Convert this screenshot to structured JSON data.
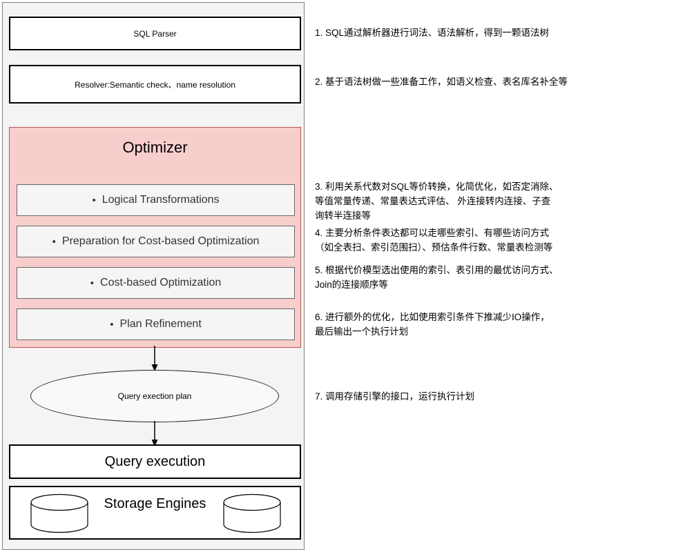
{
  "diagram": {
    "title": "SQL query processing pipeline",
    "colors": {
      "container_bg": "#f4f4f4",
      "container_border": "#808080",
      "optimizer_fill": "#f8cecc",
      "optimizer_border": "#b85450",
      "subbox_fill": "#f5f5f5",
      "subbox_border": "#666666",
      "box_border": "#000000"
    },
    "nodes": {
      "sql_parser": "SQL Parser",
      "resolver": "Resolver:Semantic check、name resolution",
      "optimizer_title": "Optimizer",
      "optimizer_steps": [
        "Logical Transformations",
        "Preparation for Cost-based Optimization",
        "Cost-based Optimization",
        "Plan Refinement"
      ],
      "bullet_glyph": "•",
      "query_execution_plan": "Query exection plan",
      "query_execution": "Query execution",
      "storage_engines": "Storage Engines"
    }
  },
  "notes": [
    {
      "id": "note-1",
      "text": "1. SQL通过解析器进行词法、语法解析，得到一颗语法树"
    },
    {
      "id": "note-2",
      "text": "2. 基于语法树做一些准备工作，如语义检查、表名库名补全等"
    },
    {
      "id": "note-3",
      "text": "3. 利用关系代数对SQL等价转换，化简优化，如否定消除、\n等值常量传递、常量表达式评估、 外连接转内连接、子查\n询转半连接等"
    },
    {
      "id": "note-4",
      "text": "4. 主要分析条件表达都可以走哪些索引、有哪些访问方式\n（如全表扫、索引范围扫）、预估条件行数、常量表检测等"
    },
    {
      "id": "note-5",
      "text": "5. 根据代价模型选出使用的索引、表引用的最优访问方式、\nJoin的连接顺序等"
    },
    {
      "id": "note-6",
      "text": "6. 进行额外的优化，比如使用索引条件下推减少IO操作，\n最后输出一个执行计划"
    },
    {
      "id": "note-7",
      "text": "7. 调用存储引擎的接口，运行执行计划"
    }
  ]
}
